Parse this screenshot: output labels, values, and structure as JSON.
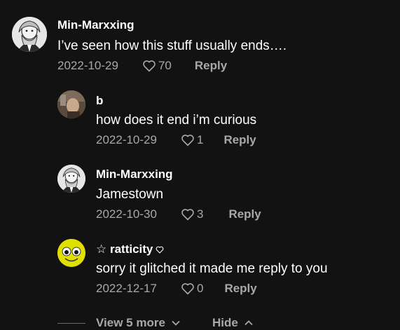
{
  "comments": [
    {
      "username": "Min-Marxxing",
      "text": "I’ve seen how this stuff usually ends….",
      "date": "2022-10-29",
      "likes": "70",
      "reply": "Reply",
      "avatar_icon": "marx-portrait-icon"
    },
    {
      "username": "b",
      "text": "how does it end i’m curious",
      "date": "2022-10-29",
      "likes": "1",
      "reply": "Reply",
      "avatar_icon": "photo-avatar-icon"
    },
    {
      "username": "Min-Marxxing",
      "text": "Jamestown",
      "date": "2022-10-30",
      "likes": "3",
      "reply": "Reply",
      "avatar_icon": "marx-portrait-icon"
    },
    {
      "username": "☆ ratticity",
      "username_suffix_icon": "heart-outline-icon",
      "text": "sorry it glitched it made me reply to you",
      "date": "2022-12-17",
      "likes": "0",
      "reply": "Reply",
      "avatar_icon": "smiley-face-icon"
    }
  ],
  "footer": {
    "view_more": "View 5 more",
    "hide": "Hide"
  },
  "colors": {
    "background": "#121212",
    "text": "#ffffff",
    "muted": "#a8a8a8"
  }
}
